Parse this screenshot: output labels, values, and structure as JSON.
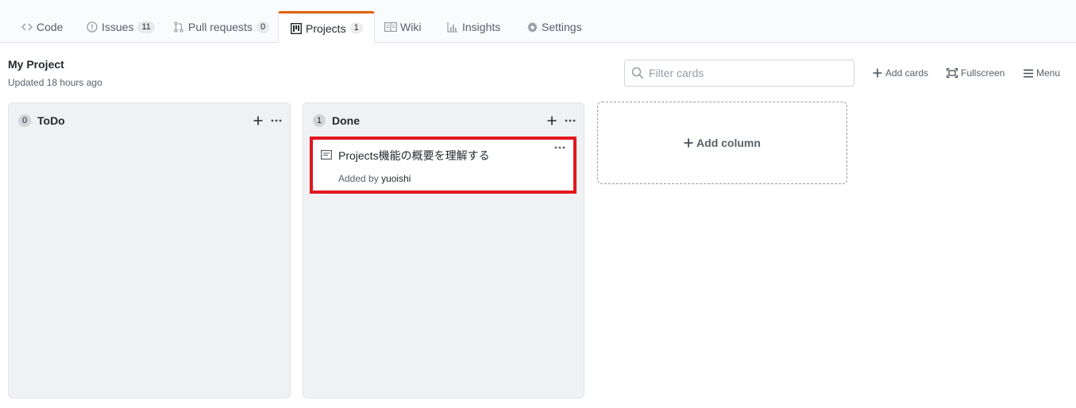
{
  "tabs": [
    {
      "label": "Code"
    },
    {
      "label": "Issues",
      "count": "11"
    },
    {
      "label": "Pull requests",
      "count": "0"
    },
    {
      "label": "Projects",
      "count": "1"
    },
    {
      "label": "Wiki"
    },
    {
      "label": "Insights"
    },
    {
      "label": "Settings"
    }
  ],
  "project": {
    "title": "My Project",
    "updated": "Updated 18 hours ago"
  },
  "filter": {
    "placeholder": "Filter cards"
  },
  "header_buttons": {
    "add_cards": "Add cards",
    "fullscreen": "Fullscreen",
    "menu": "Menu"
  },
  "columns": [
    {
      "count": "0",
      "name": "ToDo"
    },
    {
      "count": "1",
      "name": "Done",
      "card": {
        "title": "Projects機能の概要を理解する",
        "added_by_prefix": "Added by",
        "author": "yuoishi"
      }
    }
  ],
  "add_column": {
    "label": "Add column"
  },
  "colors": {
    "accent_tab": "#e36209",
    "highlight_border": "#e3161f",
    "column_bg": "#eff1f3"
  },
  "icons": {
    "code": "code-icon",
    "issues": "issue-icon",
    "pulls": "pull-request-icon",
    "projects": "project-icon",
    "wiki": "book-icon",
    "insights": "graph-icon",
    "settings": "gear-icon"
  }
}
